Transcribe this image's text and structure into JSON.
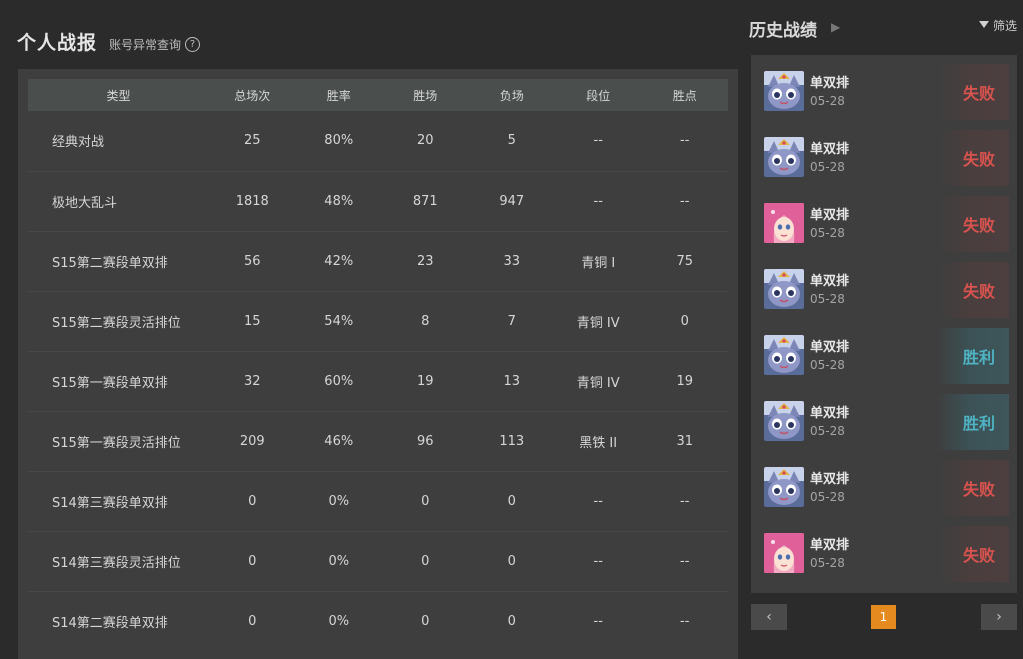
{
  "stats": {
    "title": "个人战报",
    "subtitle": "账号异常查询",
    "help_icon": "question-circle-icon",
    "columns": [
      "类型",
      "总场次",
      "胜率",
      "胜场",
      "负场",
      "段位",
      "胜点"
    ],
    "rows": [
      [
        "经典对战",
        "25",
        "80%",
        "20",
        "5",
        "--",
        "--"
      ],
      [
        "极地大乱斗",
        "1818",
        "48%",
        "871",
        "947",
        "--",
        "--"
      ],
      [
        "S15第二赛段单双排",
        "56",
        "42%",
        "23",
        "33",
        "青铜 I",
        "75"
      ],
      [
        "S15第二赛段灵活排位",
        "15",
        "54%",
        "8",
        "7",
        "青铜 IV",
        "0"
      ],
      [
        "S15第一赛段单双排",
        "32",
        "60%",
        "19",
        "13",
        "青铜 IV",
        "19"
      ],
      [
        "S15第一赛段灵活排位",
        "209",
        "46%",
        "96",
        "113",
        "黑铁 II",
        "31"
      ],
      [
        "S14第三赛段单双排",
        "0",
        "0%",
        "0",
        "0",
        "--",
        "--"
      ],
      [
        "S14第三赛段灵活排位",
        "0",
        "0%",
        "0",
        "0",
        "--",
        "--"
      ],
      [
        "S14第二赛段单双排",
        "0",
        "0%",
        "0",
        "0",
        "--",
        "--"
      ]
    ]
  },
  "history": {
    "title": "历史战绩",
    "filter_label": "筛选",
    "matches": [
      {
        "mode": "单双排",
        "date": "05-28",
        "result": "失败",
        "outcome": "lose",
        "champion": "yuumi-avatar"
      },
      {
        "mode": "单双排",
        "date": "05-28",
        "result": "失败",
        "outcome": "lose",
        "champion": "yuumi-avatar"
      },
      {
        "mode": "单双排",
        "date": "05-28",
        "result": "失败",
        "outcome": "lose",
        "champion": "seraphine-avatar"
      },
      {
        "mode": "单双排",
        "date": "05-28",
        "result": "失败",
        "outcome": "lose",
        "champion": "yuumi-avatar"
      },
      {
        "mode": "单双排",
        "date": "05-28",
        "result": "胜利",
        "outcome": "win",
        "champion": "yuumi-avatar"
      },
      {
        "mode": "单双排",
        "date": "05-28",
        "result": "胜利",
        "outcome": "win",
        "champion": "yuumi-avatar"
      },
      {
        "mode": "单双排",
        "date": "05-28",
        "result": "失败",
        "outcome": "lose",
        "champion": "yuumi-avatar"
      },
      {
        "mode": "单双排",
        "date": "05-28",
        "result": "失败",
        "outcome": "lose",
        "champion": "seraphine-avatar"
      }
    ],
    "pager": {
      "prev": "‹",
      "current": "1",
      "next": "›"
    }
  },
  "colors": {
    "lose": "#d9534f",
    "win": "#4fb3c4",
    "page_active": "#e58a1f"
  }
}
